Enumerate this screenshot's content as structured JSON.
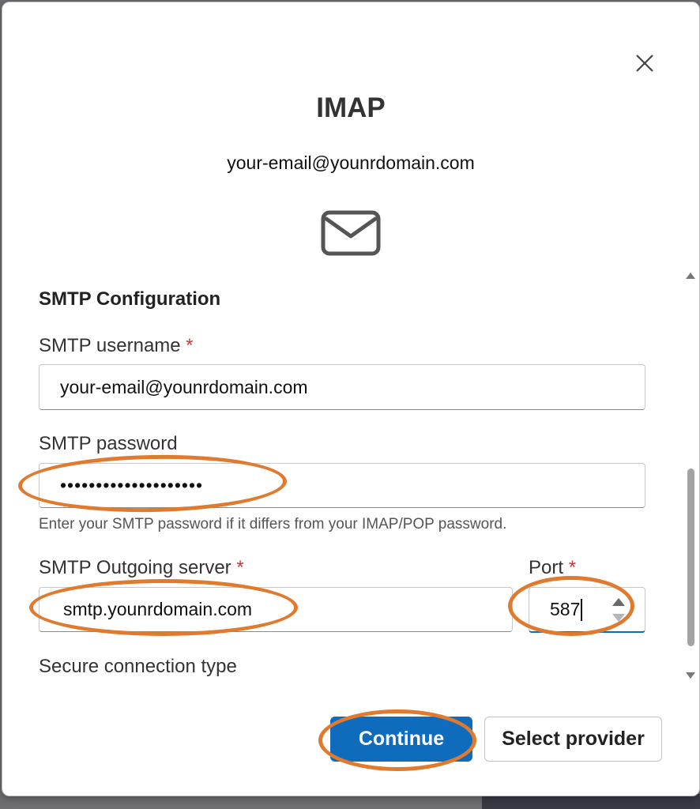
{
  "dialog": {
    "title": "IMAP",
    "email": "your-email@younrdomain.com",
    "close_icon": "close-icon",
    "mail_icon": "envelope-icon"
  },
  "smtp": {
    "section_title": "SMTP Configuration",
    "username": {
      "label": "SMTP username",
      "required_mark": "*",
      "value": "your-email@younrdomain.com"
    },
    "password": {
      "label": "SMTP password",
      "value": "••••••••••••••••••••",
      "hint": "Enter your SMTP password if it differs from your IMAP/POP password."
    },
    "server": {
      "label": "SMTP Outgoing server",
      "required_mark": "*",
      "value": "smtp.younrdomain.com"
    },
    "port": {
      "label": "Port",
      "required_mark": "*",
      "value": "587"
    },
    "secure_label": "Secure connection type"
  },
  "buttons": {
    "continue_label": "Continue",
    "select_provider_label": "Select provider"
  },
  "colors": {
    "accent": "#0f6cbd",
    "annotation": "#e07a2e",
    "required": "#c43b3b"
  }
}
